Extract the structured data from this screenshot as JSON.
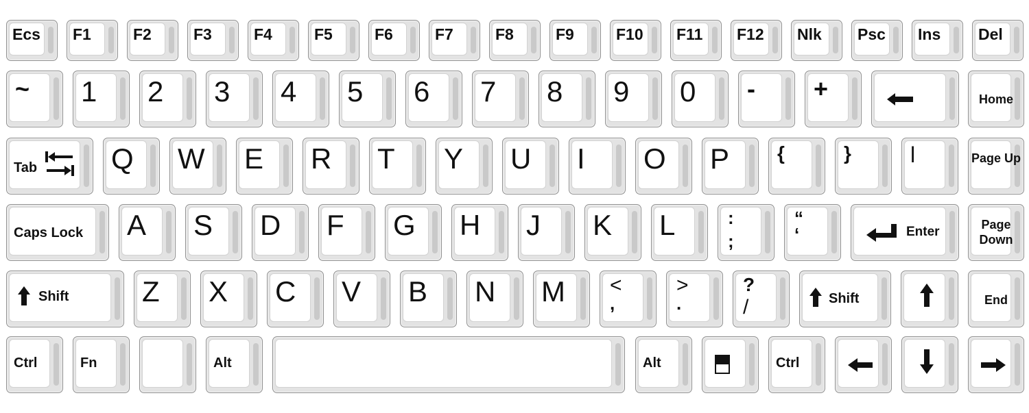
{
  "rows": {
    "r0": [
      "Ecs",
      "F1",
      "F2",
      "F3",
      "F4",
      "F5",
      "F6",
      "F7",
      "F8",
      "F9",
      "F10",
      "F11",
      "F12",
      "Nlk",
      "Psc",
      "Ins",
      "Del"
    ],
    "r1": [
      "~",
      "1",
      "2",
      "3",
      "4",
      "5",
      "6",
      "7",
      "8",
      "9",
      "0",
      "-",
      "+"
    ],
    "r2": [
      "Q",
      "W",
      "E",
      "R",
      "T",
      "Y",
      "U",
      "I",
      "O",
      "P",
      "{",
      "}",
      "l"
    ],
    "r3": [
      "A",
      "S",
      "D",
      "F",
      "G",
      "H",
      "J",
      "K",
      "L"
    ],
    "r4": [
      "Z",
      "X",
      "C",
      "V",
      "B",
      "N",
      "M"
    ]
  },
  "labels": {
    "home": "Home",
    "tab": "Tab",
    "page_up": "Page Up",
    "caps_lock": "Caps Lock",
    "enter": "Enter",
    "page_down": "Page Down",
    "shift": "Shift",
    "end": "End",
    "ctrl": "Ctrl",
    "fn": "Fn",
    "alt": "Alt"
  },
  "dual": {
    "semicolon": {
      "top": ":",
      "bottom": ";"
    },
    "quote": {
      "top": "“",
      "bottom": "‘"
    },
    "comma": {
      "top": "<",
      "bottom": ","
    },
    "period": {
      "top": ">",
      "bottom": "."
    },
    "slash": {
      "top": "?",
      "bottom": "/"
    }
  },
  "icons": {
    "backspace": "arrow-left-icon",
    "tab": "tab-arrows-icon",
    "enter": "enter-arrow-icon",
    "shift": "arrow-up-icon",
    "menu": "window-icon",
    "up": "arrow-up-icon",
    "left": "arrow-left-icon",
    "down": "arrow-down-icon",
    "right": "arrow-right-icon"
  },
  "colors": {
    "key_face": "#ffffff",
    "key_border": "#8f8f8f",
    "key_stripe": "#c9c9c9",
    "text": "#111111"
  }
}
